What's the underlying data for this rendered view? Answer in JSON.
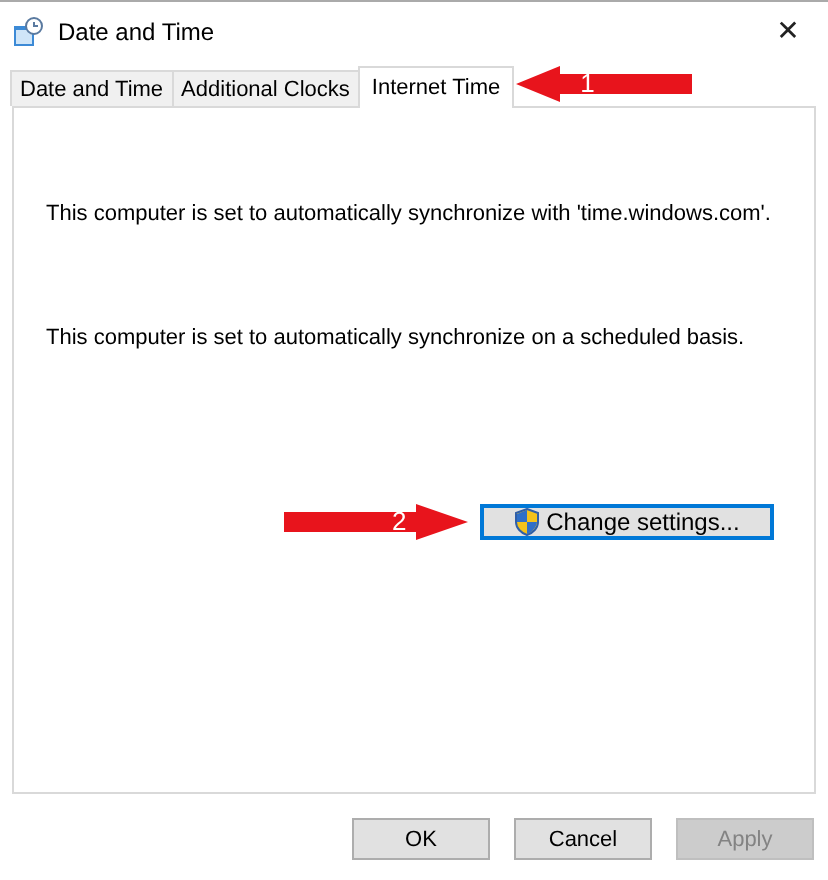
{
  "window": {
    "title": "Date and Time",
    "close": "✕"
  },
  "tabs": [
    {
      "label": "Date and Time",
      "selected": false
    },
    {
      "label": "Additional Clocks",
      "selected": false
    },
    {
      "label": "Internet Time",
      "selected": true
    }
  ],
  "messages": [
    "This computer is set to automatically synchronize with 'time.windows.com'.",
    "This computer is set to automatically synchronize on a scheduled basis."
  ],
  "change_button": {
    "label": "Change settings..."
  },
  "annotations": [
    {
      "label": "1",
      "kind": "left"
    },
    {
      "label": "2",
      "kind": "right"
    }
  ],
  "buttons": [
    {
      "label": "OK",
      "disabled": false
    },
    {
      "label": "Cancel",
      "disabled": false
    },
    {
      "label": "Apply",
      "disabled": true
    }
  ]
}
